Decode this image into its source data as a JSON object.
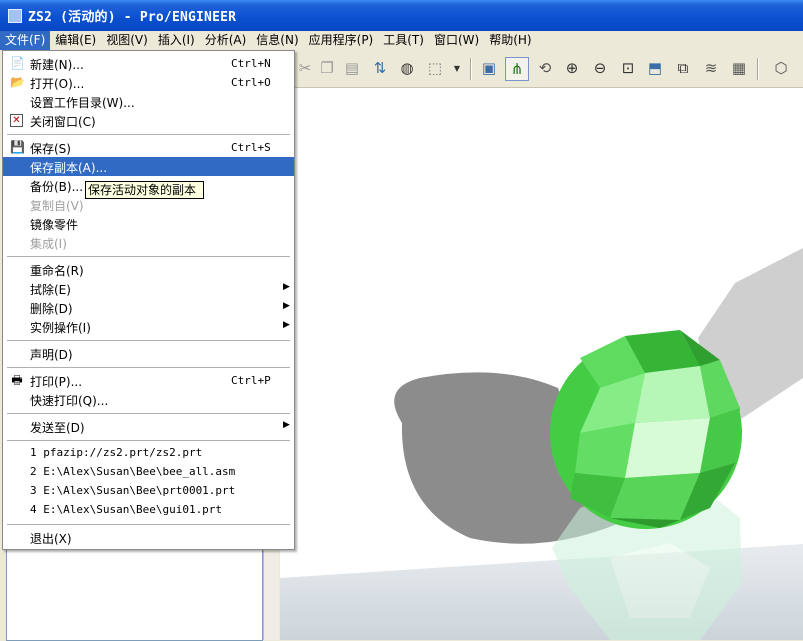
{
  "window": {
    "title": "ZS2 (活动的) - Pro/ENGINEER"
  },
  "menubar": [
    {
      "label": "文件(F)"
    },
    {
      "label": "编辑(E)"
    },
    {
      "label": "视图(V)"
    },
    {
      "label": "插入(I)"
    },
    {
      "label": "分析(A)"
    },
    {
      "label": "信息(N)"
    },
    {
      "label": "应用程序(P)"
    },
    {
      "label": "工具(T)"
    },
    {
      "label": "窗口(W)"
    },
    {
      "label": "帮助(H)"
    }
  ],
  "file_menu": {
    "new": {
      "label": "新建(N)...",
      "shortcut": "Ctrl+N"
    },
    "open": {
      "label": "打开(O)...",
      "shortcut": "Ctrl+O"
    },
    "set_working_dir": {
      "label": "设置工作目录(W)..."
    },
    "close_window": {
      "label": "关闭窗口(C)"
    },
    "save": {
      "label": "保存(S)",
      "shortcut": "Ctrl+S"
    },
    "save_copy": {
      "label": "保存副本(A)..."
    },
    "backup": {
      "label": "备份(B)..."
    },
    "copy_from": {
      "label": "复制自(V)"
    },
    "mirror_part": {
      "label": "镜像零件"
    },
    "integrate": {
      "label": "集成(I)"
    },
    "rename": {
      "label": "重命名(R)"
    },
    "erase": {
      "label": "拭除(E)"
    },
    "delete": {
      "label": "删除(D)"
    },
    "instance_ops": {
      "label": "实例操作(I)"
    },
    "declare": {
      "label": "声明(D)"
    },
    "print": {
      "label": "打印(P)...",
      "shortcut": "Ctrl+P"
    },
    "quick_print": {
      "label": "快速打印(Q)..."
    },
    "send_to": {
      "label": "发送至(D)"
    },
    "recent": [
      {
        "label": "1 pfazip://zs2.prt/zs2.prt"
      },
      {
        "label": "2 E:\\Alex\\Susan\\Bee\\bee_all.asm"
      },
      {
        "label": "3 E:\\Alex\\Susan\\Bee\\prt0001.prt"
      },
      {
        "label": "4 E:\\Alex\\Susan\\Bee\\gui01.prt"
      }
    ],
    "exit": {
      "label": "退出(X)"
    }
  },
  "tooltip": {
    "text": "保存活动对象的副本"
  },
  "colors": {
    "titlebar": "#0a4fd0",
    "highlight": "#316ac5",
    "sphere": "#44cc44",
    "tooltip_bg": "#ffffe1"
  }
}
